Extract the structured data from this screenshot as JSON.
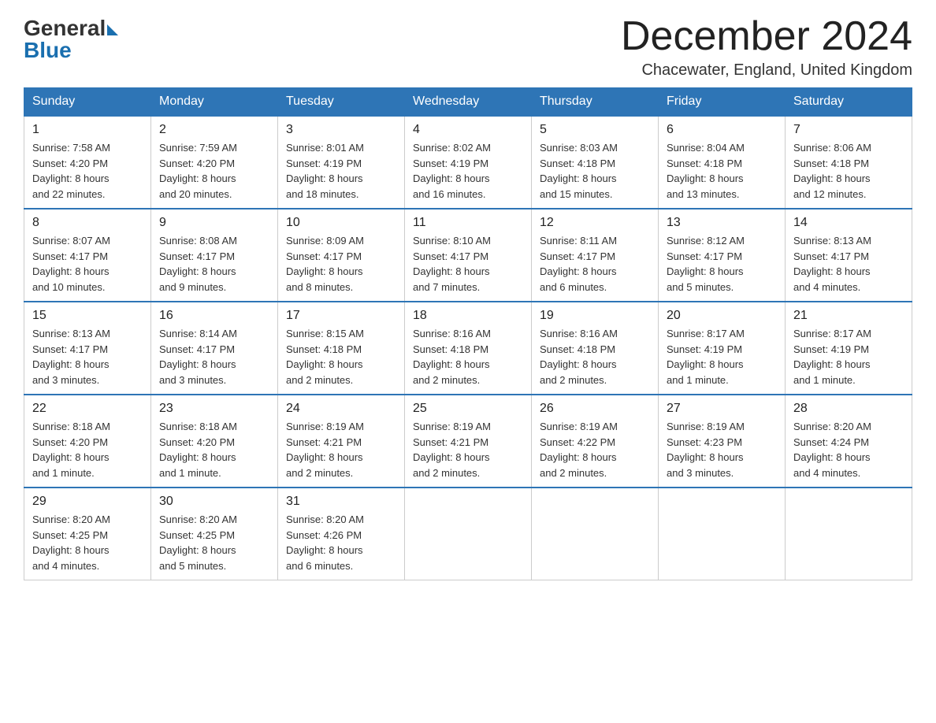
{
  "header": {
    "logo_general": "General",
    "logo_blue": "Blue",
    "month_title": "December 2024",
    "location": "Chacewater, England, United Kingdom"
  },
  "calendar": {
    "days_of_week": [
      "Sunday",
      "Monday",
      "Tuesday",
      "Wednesday",
      "Thursday",
      "Friday",
      "Saturday"
    ],
    "weeks": [
      [
        {
          "day": "1",
          "info": "Sunrise: 7:58 AM\nSunset: 4:20 PM\nDaylight: 8 hours\nand 22 minutes."
        },
        {
          "day": "2",
          "info": "Sunrise: 7:59 AM\nSunset: 4:20 PM\nDaylight: 8 hours\nand 20 minutes."
        },
        {
          "day": "3",
          "info": "Sunrise: 8:01 AM\nSunset: 4:19 PM\nDaylight: 8 hours\nand 18 minutes."
        },
        {
          "day": "4",
          "info": "Sunrise: 8:02 AM\nSunset: 4:19 PM\nDaylight: 8 hours\nand 16 minutes."
        },
        {
          "day": "5",
          "info": "Sunrise: 8:03 AM\nSunset: 4:18 PM\nDaylight: 8 hours\nand 15 minutes."
        },
        {
          "day": "6",
          "info": "Sunrise: 8:04 AM\nSunset: 4:18 PM\nDaylight: 8 hours\nand 13 minutes."
        },
        {
          "day": "7",
          "info": "Sunrise: 8:06 AM\nSunset: 4:18 PM\nDaylight: 8 hours\nand 12 minutes."
        }
      ],
      [
        {
          "day": "8",
          "info": "Sunrise: 8:07 AM\nSunset: 4:17 PM\nDaylight: 8 hours\nand 10 minutes."
        },
        {
          "day": "9",
          "info": "Sunrise: 8:08 AM\nSunset: 4:17 PM\nDaylight: 8 hours\nand 9 minutes."
        },
        {
          "day": "10",
          "info": "Sunrise: 8:09 AM\nSunset: 4:17 PM\nDaylight: 8 hours\nand 8 minutes."
        },
        {
          "day": "11",
          "info": "Sunrise: 8:10 AM\nSunset: 4:17 PM\nDaylight: 8 hours\nand 7 minutes."
        },
        {
          "day": "12",
          "info": "Sunrise: 8:11 AM\nSunset: 4:17 PM\nDaylight: 8 hours\nand 6 minutes."
        },
        {
          "day": "13",
          "info": "Sunrise: 8:12 AM\nSunset: 4:17 PM\nDaylight: 8 hours\nand 5 minutes."
        },
        {
          "day": "14",
          "info": "Sunrise: 8:13 AM\nSunset: 4:17 PM\nDaylight: 8 hours\nand 4 minutes."
        }
      ],
      [
        {
          "day": "15",
          "info": "Sunrise: 8:13 AM\nSunset: 4:17 PM\nDaylight: 8 hours\nand 3 minutes."
        },
        {
          "day": "16",
          "info": "Sunrise: 8:14 AM\nSunset: 4:17 PM\nDaylight: 8 hours\nand 3 minutes."
        },
        {
          "day": "17",
          "info": "Sunrise: 8:15 AM\nSunset: 4:18 PM\nDaylight: 8 hours\nand 2 minutes."
        },
        {
          "day": "18",
          "info": "Sunrise: 8:16 AM\nSunset: 4:18 PM\nDaylight: 8 hours\nand 2 minutes."
        },
        {
          "day": "19",
          "info": "Sunrise: 8:16 AM\nSunset: 4:18 PM\nDaylight: 8 hours\nand 2 minutes."
        },
        {
          "day": "20",
          "info": "Sunrise: 8:17 AM\nSunset: 4:19 PM\nDaylight: 8 hours\nand 1 minute."
        },
        {
          "day": "21",
          "info": "Sunrise: 8:17 AM\nSunset: 4:19 PM\nDaylight: 8 hours\nand 1 minute."
        }
      ],
      [
        {
          "day": "22",
          "info": "Sunrise: 8:18 AM\nSunset: 4:20 PM\nDaylight: 8 hours\nand 1 minute."
        },
        {
          "day": "23",
          "info": "Sunrise: 8:18 AM\nSunset: 4:20 PM\nDaylight: 8 hours\nand 1 minute."
        },
        {
          "day": "24",
          "info": "Sunrise: 8:19 AM\nSunset: 4:21 PM\nDaylight: 8 hours\nand 2 minutes."
        },
        {
          "day": "25",
          "info": "Sunrise: 8:19 AM\nSunset: 4:21 PM\nDaylight: 8 hours\nand 2 minutes."
        },
        {
          "day": "26",
          "info": "Sunrise: 8:19 AM\nSunset: 4:22 PM\nDaylight: 8 hours\nand 2 minutes."
        },
        {
          "day": "27",
          "info": "Sunrise: 8:19 AM\nSunset: 4:23 PM\nDaylight: 8 hours\nand 3 minutes."
        },
        {
          "day": "28",
          "info": "Sunrise: 8:20 AM\nSunset: 4:24 PM\nDaylight: 8 hours\nand 4 minutes."
        }
      ],
      [
        {
          "day": "29",
          "info": "Sunrise: 8:20 AM\nSunset: 4:25 PM\nDaylight: 8 hours\nand 4 minutes."
        },
        {
          "day": "30",
          "info": "Sunrise: 8:20 AM\nSunset: 4:25 PM\nDaylight: 8 hours\nand 5 minutes."
        },
        {
          "day": "31",
          "info": "Sunrise: 8:20 AM\nSunset: 4:26 PM\nDaylight: 8 hours\nand 6 minutes."
        },
        null,
        null,
        null,
        null
      ]
    ]
  }
}
